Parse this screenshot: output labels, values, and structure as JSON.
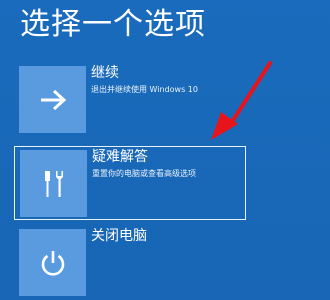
{
  "title": "选择一个选项",
  "options": [
    {
      "label": "继续",
      "description": "退出并继续使用 Windows 10",
      "icon": "arrow-right-icon"
    },
    {
      "label": "疑难解答",
      "description": "重置你的电脑或查看高级选项",
      "icon": "tools-icon"
    },
    {
      "label": "关闭电脑",
      "description": "",
      "icon": "power-icon"
    }
  ],
  "colors": {
    "background": "#1868b8",
    "tile": "#5a9be0",
    "annotation_arrow": "#e8141b"
  }
}
